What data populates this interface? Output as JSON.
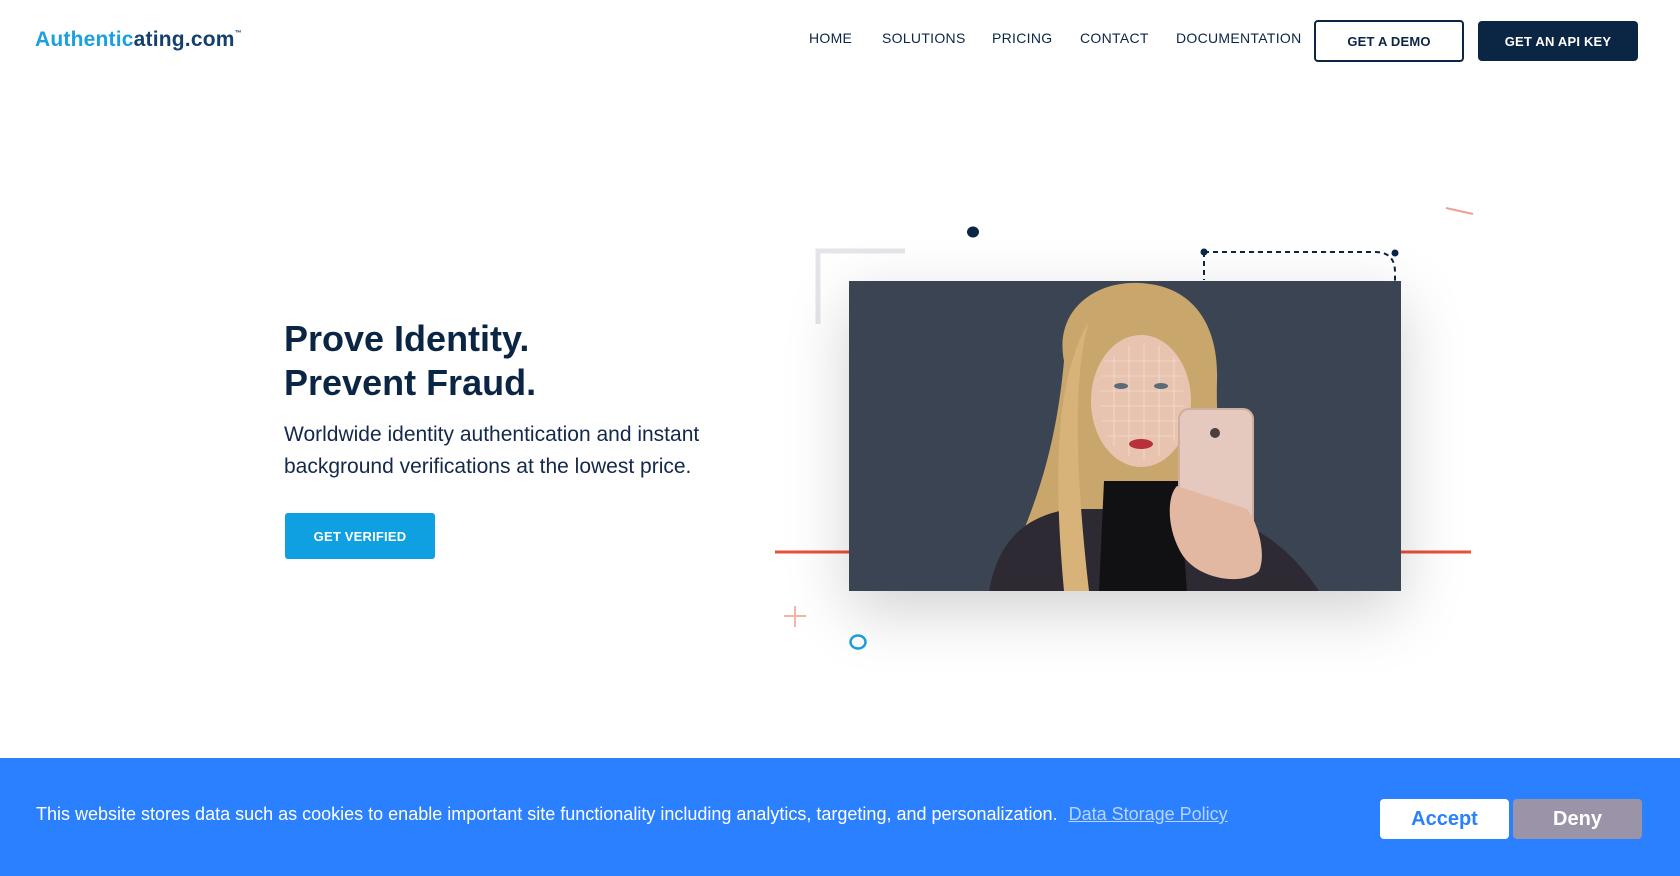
{
  "brand": {
    "logo_part1": "Authentic",
    "logo_part2": "ating.com",
    "logo_tm": "™",
    "colors": {
      "primary_blue": "#1a9fe0",
      "navy": "#0b2545",
      "accent_red": "#e8503a",
      "cookie_blue": "#2b80ff"
    }
  },
  "nav": {
    "items": [
      {
        "label": "HOME"
      },
      {
        "label": "SOLUTIONS"
      },
      {
        "label": "PRICING"
      },
      {
        "label": "CONTACT"
      },
      {
        "label": "DOCUMENTATION"
      }
    ],
    "demo_button": "GET A DEMO",
    "api_button": "GET AN API KEY"
  },
  "hero": {
    "headline_line1": "Prove Identity.",
    "headline_line2": "Prevent Fraud.",
    "subtext": "Worldwide identity authentication and instant background verifications at the lowest price.",
    "cta": "GET VERIFIED"
  },
  "cookie_banner": {
    "message": "This website stores data such as cookies to enable important site functionality including analytics, targeting, and personalization.",
    "policy_link": "Data Storage Policy",
    "accept": "Accept",
    "deny": "Deny"
  }
}
